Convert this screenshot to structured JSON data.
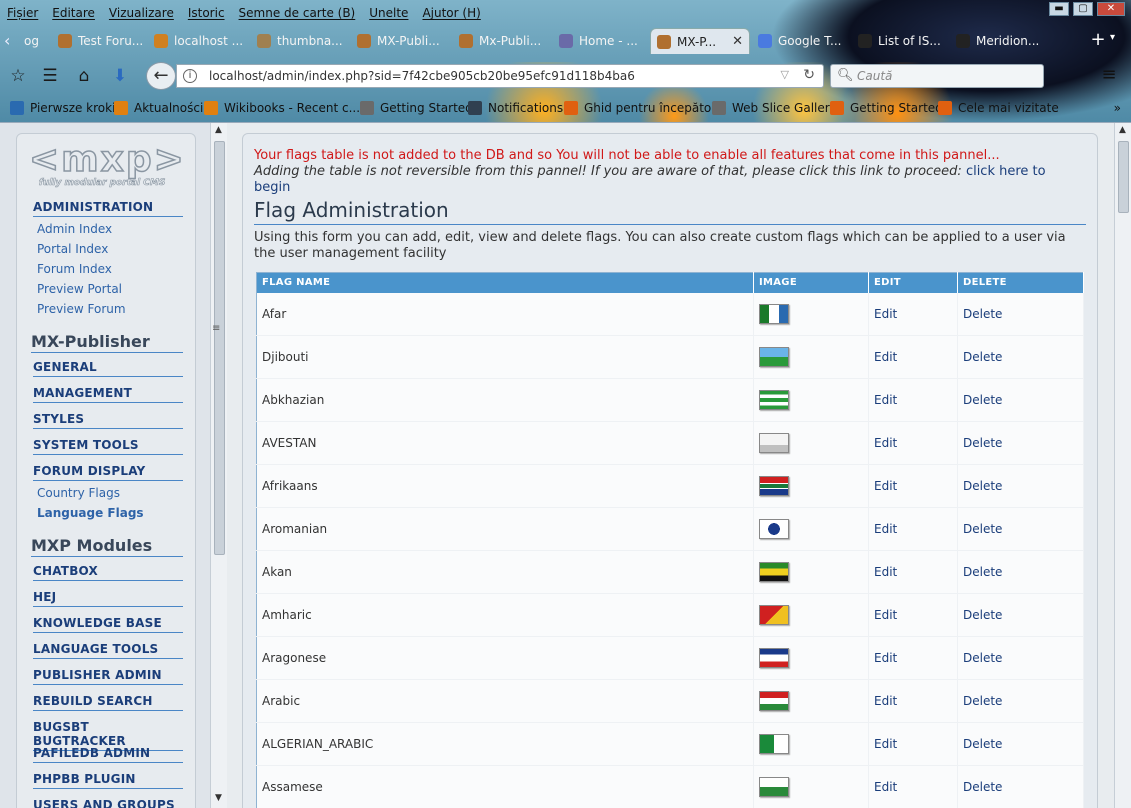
{
  "browser": {
    "menu": [
      "Fișier",
      "Editare",
      "Vizualizare",
      "Istoric",
      "Semne de carte (B)",
      "Unelte",
      "Ajutor (H)"
    ],
    "window_controls": {
      "minimize": "▬",
      "maximize": "▢",
      "close": "✕"
    },
    "tabs": [
      {
        "label": "og",
        "icon_color": "#888"
      },
      {
        "label": "Test Foru...",
        "icon_color": "#b07030"
      },
      {
        "label": "localhost ...",
        "icon_color": "#d08020"
      },
      {
        "label": "thumbna...",
        "icon_color": "#a08050"
      },
      {
        "label": "MX-Publi...",
        "icon_color": "#b07030"
      },
      {
        "label": "Mx-Publi...",
        "icon_color": "#b07030"
      },
      {
        "label": "Home - ...",
        "icon_color": "#6a6aa8"
      },
      {
        "label": "MX-P...",
        "icon_color": "#b07030"
      },
      {
        "label": "Google T...",
        "icon_color": "#4a7ae0"
      },
      {
        "label": "List of IS...",
        "icon_color": "#222"
      },
      {
        "label": "Meridion...",
        "icon_color": "#222"
      }
    ],
    "active_tab": "MX-P...",
    "new_tab": "+",
    "url": "localhost/admin/index.php?sid=7f42cbe905cb20be95efc91d118b4ba6",
    "search_placeholder": "Caută",
    "bookmarks": [
      {
        "label": "Pierwsze kroki",
        "icon_color": "#2a6ab0"
      },
      {
        "label": "Aktualności",
        "icon_color": "#e08010"
      },
      {
        "label": "Wikibooks - Recent c...",
        "icon_color": "#e08010"
      },
      {
        "label": "Getting Started",
        "icon_color": "#6a6a6a"
      },
      {
        "label": "Notifications",
        "icon_color": "#304050"
      },
      {
        "label": "Ghid pentru începători",
        "icon_color": "#e06010"
      },
      {
        "label": "Web Slice Gallery",
        "icon_color": "#6a6a6a"
      },
      {
        "label": "Getting Started",
        "icon_color": "#e06010"
      },
      {
        "label": "Cele mai vizitate",
        "icon_color": "#e06010"
      }
    ],
    "bookmarks_more": "»"
  },
  "sidebar": {
    "logo": {
      "mark": "<mxp>",
      "sub": "fully modular portal CMS"
    },
    "administration": {
      "heading": "ADMINISTRATION",
      "links": [
        "Admin Index",
        "Portal Index",
        "Forum Index",
        "Preview Portal",
        "Preview Forum"
      ]
    },
    "publisher_title": "MX-Publisher",
    "publisher_sections": [
      "GENERAL",
      "MANAGEMENT",
      "STYLES",
      "SYSTEM TOOLS",
      "FORUM DISPLAY"
    ],
    "forum_display_links": [
      {
        "label": "Country Flags",
        "current": false
      },
      {
        "label": "Language Flags",
        "current": true
      }
    ],
    "modules_title": "MXP Modules",
    "modules": [
      "CHATBOX",
      "HEJ",
      "KNOWLEDGE BASE",
      "LANGUAGE TOOLS",
      "PUBLISHER ADMIN",
      "REBUILD SEARCH",
      "BUGSBT BUGTRACKER",
      "PAFILEDB ADMIN",
      "PHPBB PLUGIN",
      "USERS AND GROUPS"
    ]
  },
  "main": {
    "warning": "Your flags table is not added to the DB and so You will not be able to enable all features that come in this pannel...",
    "notice": "Adding the table is not reversible from this pannel! If you are aware of that, please click this link to proceed:",
    "notice_link": "click here to begin",
    "title": "Flag Administration",
    "intro": "Using this form you can add, edit, view and delete flags. You can also create custom flags which can be applied to a user via the user management facility",
    "columns": [
      "FLAG NAME",
      "IMAGE",
      "EDIT",
      "DELETE"
    ],
    "edit_label": "Edit",
    "delete_label": "Delete",
    "rows": [
      {
        "name": "Afar",
        "flag": "linear-gradient(90deg,#1a7a2a 0 33%,#fff 33% 67%,#2a6ab0 67%)"
      },
      {
        "name": "Djibouti",
        "flag": "linear-gradient(180deg,#6ab4e8 0 50%,#2a9a3a 50%)"
      },
      {
        "name": "Abkhazian",
        "flag": "linear-gradient(180deg,#2a9a3a 0 20%,#fff 20% 40%,#2a9a3a 40% 60%,#fff 60% 80%,#2a9a3a 80%)"
      },
      {
        "name": "AVESTAN",
        "flag": "linear-gradient(180deg,#f4f4f4 0 60%,#c0c0c0 60%)"
      },
      {
        "name": "Afrikaans",
        "flag": "linear-gradient(180deg,#d02020 0 33%,#fff 33% 40%,#1a7a3a 40% 60%,#fff 60% 67%,#1a3a8a 67%)"
      },
      {
        "name": "Aromanian",
        "flag": "radial-gradient(circle,#1a3a8a 0 35%,#fff 36%)"
      },
      {
        "name": "Akan",
        "flag": "linear-gradient(180deg,#2a8a2a 0 30%,#f0d020 30% 70%,#111 70%)"
      },
      {
        "name": "Amharic",
        "flag": "linear-gradient(135deg,#d02020 0 50%,#f0c020 50%)"
      },
      {
        "name": "Aragonese",
        "flag": "linear-gradient(180deg,#1a3a8a 0 30%,#fff 30% 70%,#d02020 70%)"
      },
      {
        "name": "Arabic",
        "flag": "linear-gradient(180deg,#d02020 0 33%,#fff 33% 67%,#2a8a3a 67%)"
      },
      {
        "name": "ALGERIAN_ARABIC",
        "flag": "linear-gradient(90deg,#1a8a3a 0 50%,#fff 50%)"
      },
      {
        "name": "Assamese",
        "flag": "linear-gradient(180deg,#fff 0 50%,#2a8a3a 50%)"
      }
    ]
  }
}
